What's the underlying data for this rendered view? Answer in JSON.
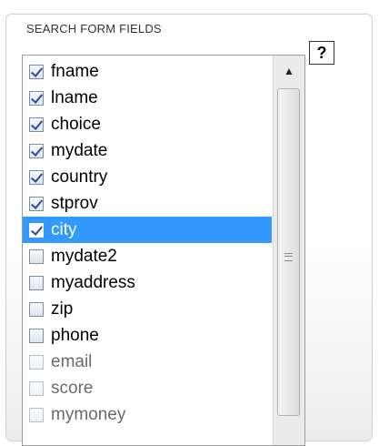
{
  "fieldset": {
    "legend": "SEARCH FORM FIELDS"
  },
  "help": {
    "label": "?"
  },
  "listbox": {
    "items": [
      {
        "label": "fname",
        "checked": true
      },
      {
        "label": "lname",
        "checked": true
      },
      {
        "label": "choice",
        "checked": true
      },
      {
        "label": "mydate",
        "checked": true
      },
      {
        "label": "country",
        "checked": true
      },
      {
        "label": "stprov",
        "checked": true
      },
      {
        "label": "city",
        "checked": true,
        "selected": true
      },
      {
        "label": "mydate2",
        "checked": false
      },
      {
        "label": "myaddress",
        "checked": false
      },
      {
        "label": "zip",
        "checked": false
      },
      {
        "label": "phone",
        "checked": false
      },
      {
        "label": "email",
        "checked": false
      },
      {
        "label": "score",
        "checked": false
      },
      {
        "label": "mymoney",
        "checked": false
      }
    ],
    "selected_color": "#3399ff"
  },
  "icons": {
    "scroll_up": "triangle-up-icon",
    "checkbox": "checkbox-icon"
  }
}
